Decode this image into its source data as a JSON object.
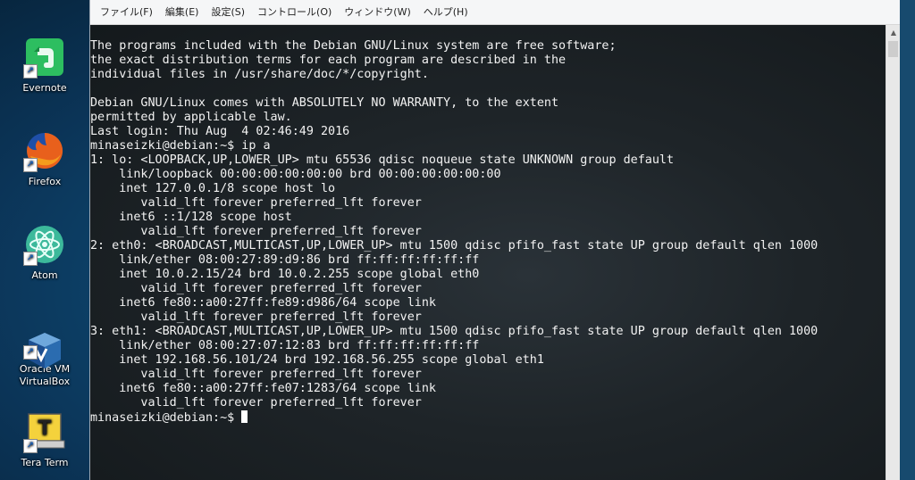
{
  "desktop": {
    "icons": [
      {
        "label": "Evernote",
        "icon": "evernote-icon"
      },
      {
        "label": "Firefox",
        "icon": "firefox-icon"
      },
      {
        "label": "Atom",
        "icon": "atom-icon"
      },
      {
        "label": "Oracle VM\nVirtualBox",
        "icon": "virtualbox-icon"
      },
      {
        "label": "Tera Term",
        "icon": "teraterm-icon"
      }
    ]
  },
  "window": {
    "menu": [
      "ファイル(F)",
      "編集(E)",
      "設定(S)",
      "コントロール(O)",
      "ウィンドウ(W)",
      "ヘルプ(H)"
    ]
  },
  "terminal": {
    "lines": [
      "The programs included with the Debian GNU/Linux system are free software;",
      "the exact distribution terms for each program are described in the",
      "individual files in /usr/share/doc/*/copyright.",
      "",
      "Debian GNU/Linux comes with ABSOLUTELY NO WARRANTY, to the extent",
      "permitted by applicable law.",
      "Last login: Thu Aug  4 02:46:49 2016",
      "minaseizki@debian:~$ ip a",
      "1: lo: <LOOPBACK,UP,LOWER_UP> mtu 65536 qdisc noqueue state UNKNOWN group default",
      "    link/loopback 00:00:00:00:00:00 brd 00:00:00:00:00:00",
      "    inet 127.0.0.1/8 scope host lo",
      "       valid_lft forever preferred_lft forever",
      "    inet6 ::1/128 scope host",
      "       valid_lft forever preferred_lft forever",
      "2: eth0: <BROADCAST,MULTICAST,UP,LOWER_UP> mtu 1500 qdisc pfifo_fast state UP group default qlen 1000",
      "    link/ether 08:00:27:89:d9:86 brd ff:ff:ff:ff:ff:ff",
      "    inet 10.0.2.15/24 brd 10.0.2.255 scope global eth0",
      "       valid_lft forever preferred_lft forever",
      "    inet6 fe80::a00:27ff:fe89:d986/64 scope link",
      "       valid_lft forever preferred_lft forever",
      "3: eth1: <BROADCAST,MULTICAST,UP,LOWER_UP> mtu 1500 qdisc pfifo_fast state UP group default qlen 1000",
      "    link/ether 08:00:27:07:12:83 brd ff:ff:ff:ff:ff:ff",
      "    inet 192.168.56.101/24 brd 192.168.56.255 scope global eth1",
      "       valid_lft forever preferred_lft forever",
      "    inet6 fe80::a00:27ff:fe07:1283/64 scope link",
      "       valid_lft forever preferred_lft forever"
    ],
    "prompt": "minaseizki@debian:~$ "
  }
}
